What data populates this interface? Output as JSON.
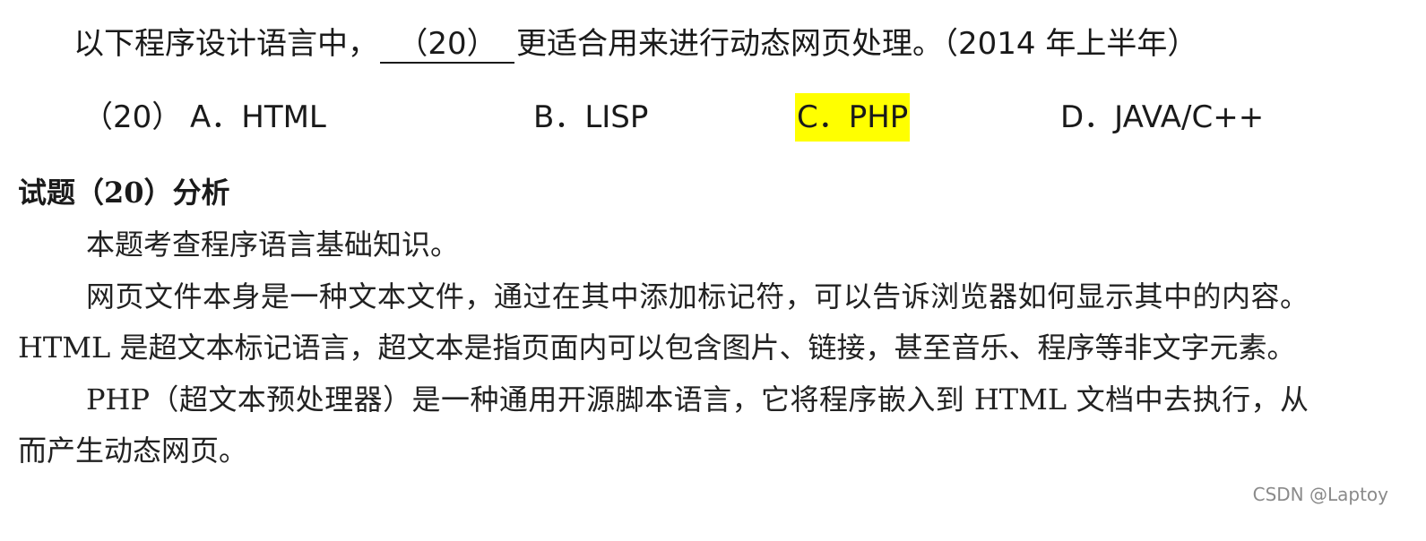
{
  "question": {
    "prefix": "以下程序设计语言中，",
    "blank": "（20）",
    "suffix": "更适合用来进行动态网页处理。（2014 年上半年）"
  },
  "options": {
    "number": "（20）",
    "a": "A．HTML",
    "b": "B．LISP",
    "c": "C．PHP",
    "d": "D．JAVA/C++",
    "highlighted": "C",
    "highlight_color": "#ffff00"
  },
  "analysis": {
    "title": "试题（20）分析",
    "paragraphs": [
      "本题考查程序语言基础知识。",
      "网页文件本身是一种文本文件，通过在其中添加标记符，可以告诉浏览器如何显示其中的内容。HTML 是超文本标记语言，超文本是指页面内可以包含图片、链接，甚至音乐、程序等非文字元素。",
      "PHP（超文本预处理器）是一种通用开源脚本语言，它将程序嵌入到 HTML 文档中去执行，从而产生动态网页。"
    ]
  },
  "watermark": "CSDN @Laptoy"
}
